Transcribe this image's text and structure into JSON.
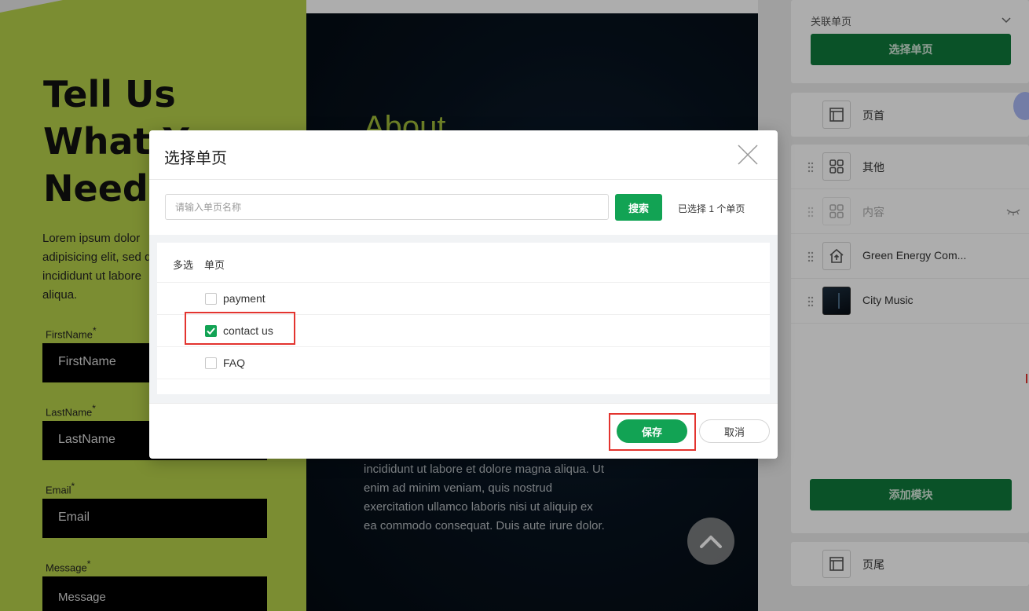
{
  "preview": {
    "hero_title": "Tell Us\nWhat Y\nNeed!",
    "hero_text": "Lorem ipsum dolor\nadipisicing elit, sed d\nincididunt ut labore\naliqua.",
    "form": {
      "firstname_label": "FirstName",
      "firstname_placeholder": "FirstName",
      "lastname_label": "LastName",
      "lastname_placeholder": "LastName",
      "email_label": "Email",
      "email_placeholder": "Email",
      "message_label": "Message",
      "message_placeholder": "Message",
      "required_mark": "*"
    },
    "about_title": "About",
    "about_text": "incididunt ut labore et dolore magna aliqua. Ut\nenim ad minim veniam, quis nostrud\nexercitation ullamco laboris nisi ut aliquip ex\nea commodo consequat. Duis aute irure dolor."
  },
  "sidebar": {
    "link_page_select": "关联单页",
    "choose_page_button": "选择单页",
    "header_module": "页首",
    "modules": [
      {
        "label": "其他",
        "icon": "grid-icon",
        "hidden": false
      },
      {
        "label": "内容",
        "icon": "grid-icon",
        "hidden": true
      },
      {
        "label": "Green Energy Com...",
        "icon": "home-upload-icon",
        "hidden": false
      },
      {
        "label": "City Music",
        "icon": "thumbnail",
        "hidden": false
      }
    ],
    "add_module_button": "添加模块",
    "footer_module": "页尾"
  },
  "modal": {
    "title": "选择单页",
    "search_placeholder": "请输入单页名称",
    "search_value": "",
    "search_button": "搜索",
    "selected_count_text": "已选择 1 个单页",
    "columns": {
      "multi": "多选",
      "page": "单页"
    },
    "rows": [
      {
        "label": "payment",
        "checked": false
      },
      {
        "label": "contact us",
        "checked": true
      },
      {
        "label": "FAQ",
        "checked": false
      }
    ],
    "save_button": "保存",
    "cancel_button": "取消"
  },
  "colors": {
    "brand_green": "#12a354",
    "dark_green": "#0f7a3c",
    "lime": "#b6d04a",
    "highlight_red": "#e3342f"
  }
}
